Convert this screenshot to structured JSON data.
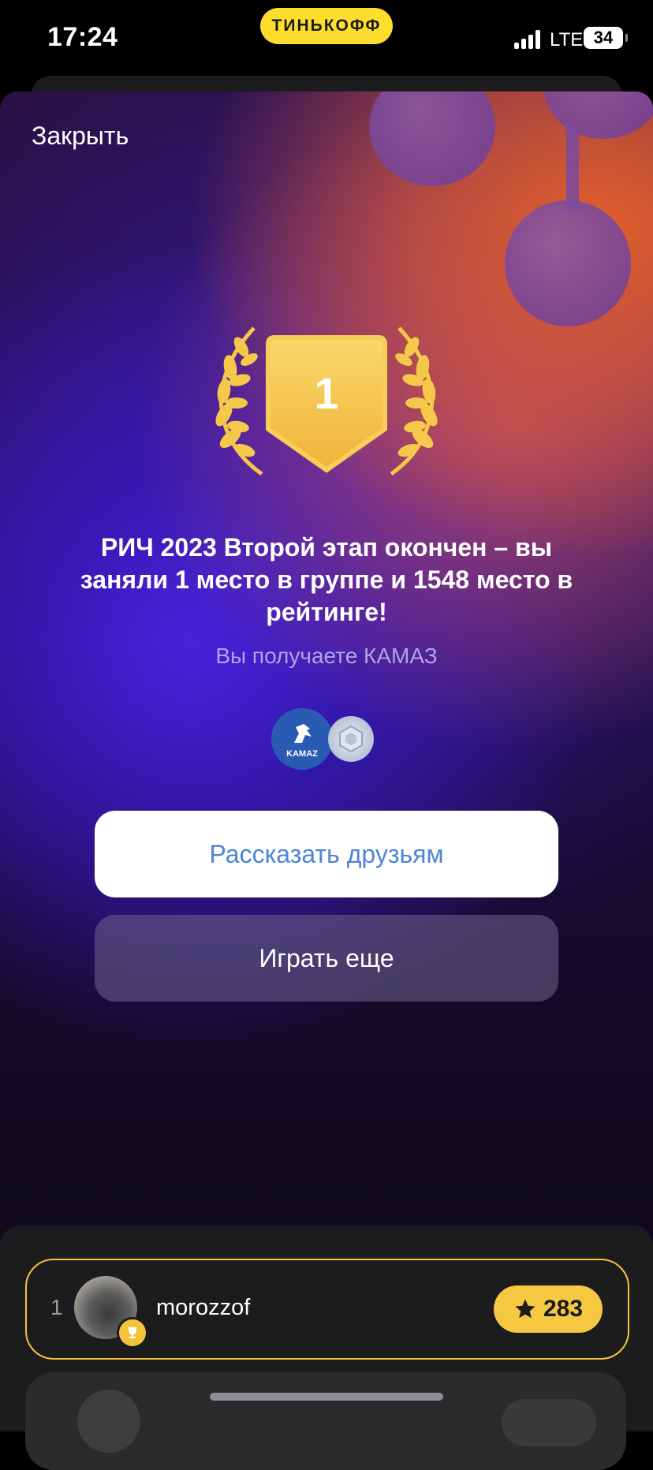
{
  "status_bar": {
    "time": "17:24",
    "brand": "ТИНЬКОФФ",
    "network": "LTE",
    "battery": "34"
  },
  "modal": {
    "close_label": "Закрыть",
    "place_number": "1",
    "title": "РИЧ 2023 Второй этап окончен – вы заняли 1 место в группе и 1548 место в рейтинге!",
    "subtitle": "Вы получаете КАМАЗ",
    "reward_logo_text": "KAMAZ",
    "share_button": "Рассказать друзьям",
    "play_again_button": "Играть еще"
  },
  "leaderboard": {
    "rows": [
      {
        "rank": "1",
        "username": "morozzof",
        "score": "283"
      }
    ]
  },
  "colors": {
    "brand_yellow": "#ffdd2d",
    "score_yellow": "#f6c740",
    "share_text_blue": "#4d84d6",
    "sheet_purple": "#3c1cb0",
    "sheet_orange": "#e0612a"
  },
  "icons": [
    "signal-icon",
    "battery-icon",
    "laurel-icon",
    "trophy-icon",
    "star-icon",
    "kamaz-logo",
    "badge-icon"
  ]
}
